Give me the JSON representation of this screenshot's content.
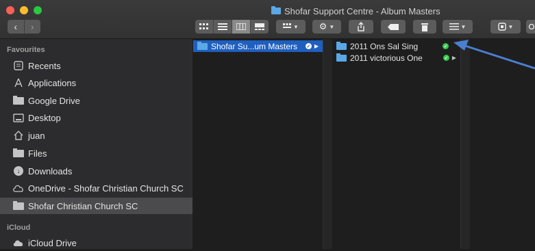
{
  "window": {
    "title": "Shofar Support Centre - Album Masters"
  },
  "toolbar": {
    "back_icon": "chevron-left",
    "forward_icon": "chevron-right",
    "back_glyph": "‹",
    "forward_glyph": "›",
    "view_modes": [
      "icon-view",
      "list-view",
      "column-view",
      "gallery-view"
    ],
    "active_view": "column-view",
    "buttons": [
      "group",
      "action",
      "share",
      "tag",
      "delete",
      "sort",
      "app-menu",
      "search"
    ]
  },
  "sidebar": {
    "favourites_header": "Favourites",
    "favourites": [
      {
        "label": "Recents",
        "icon": "recents-icon"
      },
      {
        "label": "Applications",
        "icon": "applications-icon"
      },
      {
        "label": "Google Drive",
        "icon": "folder-icon"
      },
      {
        "label": "Desktop",
        "icon": "desktop-icon"
      },
      {
        "label": "juan",
        "icon": "home-icon"
      },
      {
        "label": "Files",
        "icon": "folder-icon"
      },
      {
        "label": "Downloads",
        "icon": "downloads-icon"
      },
      {
        "label": "OneDrive - Shofar Christian Church SC",
        "icon": "cloud-icon"
      },
      {
        "label": "Shofar Christian Church SC",
        "icon": "folder-icon",
        "selected": true
      }
    ],
    "icloud_header": "iCloud",
    "icloud": [
      {
        "label": "iCloud Drive",
        "icon": "cloud-icon"
      }
    ]
  },
  "columns": {
    "col1": [
      {
        "label": "Shofar Su...um Masters",
        "synced": true,
        "selected": true
      }
    ],
    "col2": [
      {
        "label": "2011 Ons Sal Sing",
        "synced": true
      },
      {
        "label": "2011 victorious One",
        "synced": true
      }
    ]
  },
  "colors": {
    "accent": "#1f5fbf",
    "sync_green": "#34c84a",
    "annotation_arrow": "#4a7fd0"
  }
}
